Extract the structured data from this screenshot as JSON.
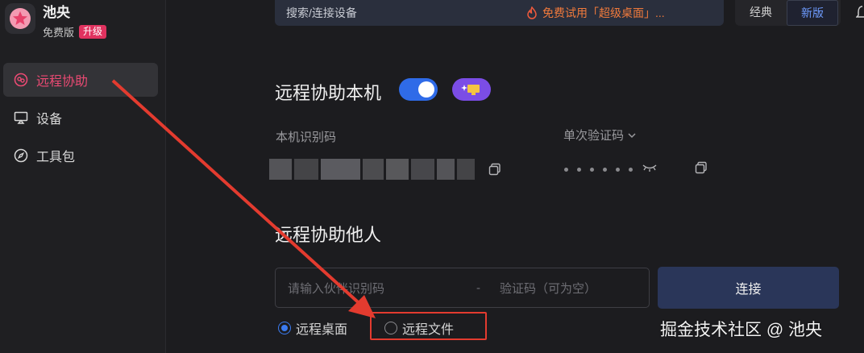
{
  "sidebar": {
    "app_name": "池央",
    "edition": "免费版",
    "upgrade_label": "升级",
    "items": [
      {
        "label": "远程协助",
        "icon": "remote-assist-icon",
        "active": true
      },
      {
        "label": "设备",
        "icon": "monitor-icon",
        "active": false
      },
      {
        "label": "工具包",
        "icon": "compass-icon",
        "active": false
      }
    ]
  },
  "topbar": {
    "search_label": "搜索/连接设备",
    "promo_text": "免费试用「超级桌面」...",
    "mode_classic": "经典",
    "mode_new": "新版",
    "active_mode": "新版"
  },
  "local": {
    "title": "远程协助本机",
    "toggle_on": true,
    "device_code_label": "本机识别码",
    "verify_code_label": "单次验证码"
  },
  "remote": {
    "title": "远程协助他人",
    "partner_placeholder": "请输入伙伴识别码",
    "separator": "-",
    "verify_placeholder": "验证码（可为空）",
    "connect_label": "连接",
    "options": [
      {
        "label": "远程桌面",
        "checked": true
      },
      {
        "label": "远程文件",
        "checked": false
      }
    ]
  },
  "watermark": "掘金技术社区 @ 池央",
  "colors": {
    "accent_pink": "#ea4a73",
    "accent_blue": "#2f6be8",
    "annotation_red": "#e33b2f"
  }
}
